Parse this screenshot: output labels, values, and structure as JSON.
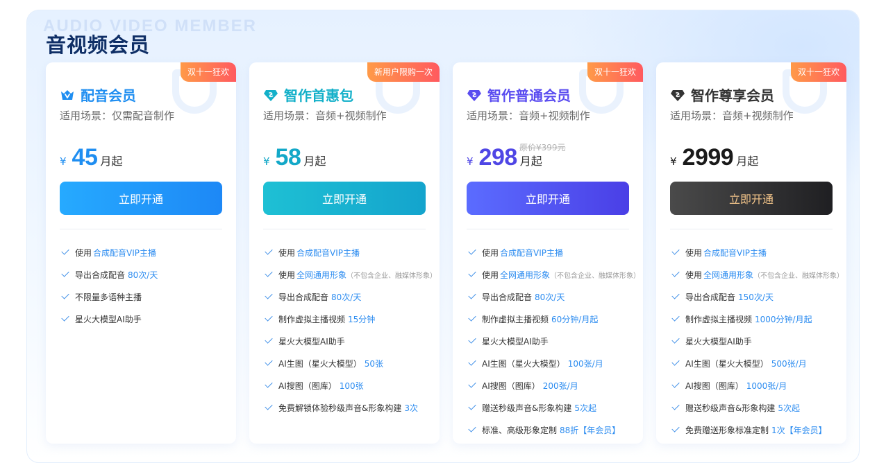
{
  "page": {
    "title": "音视频会员",
    "watermark": "AUDIO VIDEO MEMBER"
  },
  "colors": {
    "title": "#0f2f66",
    "highlight": "#2c8cf0",
    "promo_gradient": [
      "#ff9a48",
      "#ff5a5f"
    ]
  },
  "plans": [
    {
      "promo": "双十一狂欢",
      "icon": "crown-v-icon",
      "name": "配音会员",
      "name_color": "#1f8ef1",
      "scene": "适用场景：仅需配音制作",
      "currency": "¥",
      "price": "45",
      "price_color": "#1f8ef1",
      "unit": "月起",
      "original_price": "",
      "cta": "立即开通",
      "cta_gradient": [
        "#26aaff",
        "#1d88f6"
      ],
      "cta_text_color": "#ffffff",
      "features": [
        {
          "text": "使用",
          "highlight": "合成配音VIP主播",
          "note": ""
        },
        {
          "text": "导出合成配音",
          "highlight": "80次/天",
          "note": ""
        },
        {
          "text": "不限量多语种主播",
          "highlight": "",
          "note": ""
        },
        {
          "text": "星火大模型AI助手",
          "highlight": "",
          "note": ""
        }
      ]
    },
    {
      "promo": "新用户限购一次",
      "icon": "diamond-s-icon",
      "name": "智作首惠包",
      "name_color": "#13b0c9",
      "scene": "适用场景：音频+视频制作",
      "currency": "¥",
      "price": "58",
      "price_color": "#13a8c8",
      "unit": "月起",
      "original_price": "",
      "cta": "立即开通",
      "cta_gradient": [
        "#1ec0d4",
        "#14a4cd"
      ],
      "cta_text_color": "#ffffff",
      "features": [
        {
          "text": "使用",
          "highlight": "合成配音VIP主播",
          "note": ""
        },
        {
          "text": "使用",
          "highlight": "全网通用形象",
          "note": "（不包含企业、融媒体形象）"
        },
        {
          "text": "导出合成配音",
          "highlight": "80次/天",
          "note": ""
        },
        {
          "text": "制作虚拟主播视频",
          "highlight": "15分钟",
          "note": ""
        },
        {
          "text": "星火大模型AI助手",
          "highlight": "",
          "note": ""
        },
        {
          "text": "AI生图（星火大模型）",
          "highlight": "50张",
          "note": ""
        },
        {
          "text": "AI搜图（图库）",
          "highlight": "100张",
          "note": ""
        },
        {
          "text": "免费解锁体验秒级声音&形象构建",
          "highlight": "3次",
          "note": ""
        }
      ]
    },
    {
      "promo": "双十一狂欢",
      "icon": "diamond-s-icon",
      "name": "智作普通会员",
      "name_color": "#5a4cf0",
      "scene": "适用场景：音频+视频制作",
      "currency": "¥",
      "price": "298",
      "price_color": "#4f46e5",
      "unit": "月起",
      "original_price": "原价¥399元",
      "cta": "立即开通",
      "cta_gradient": [
        "#5b6cff",
        "#4a3fe6"
      ],
      "cta_text_color": "#ffffff",
      "features": [
        {
          "text": "使用",
          "highlight": "合成配音VIP主播",
          "note": ""
        },
        {
          "text": "使用",
          "highlight": "全网通用形象",
          "note": "（不包含企业、融媒体形象）"
        },
        {
          "text": "导出合成配音",
          "highlight": "80次/天",
          "note": ""
        },
        {
          "text": "制作虚拟主播视频",
          "highlight": "60分钟/月起",
          "note": ""
        },
        {
          "text": "星火大模型AI助手",
          "highlight": "",
          "note": ""
        },
        {
          "text": "AI生图（星火大模型）",
          "highlight": "100张/月",
          "note": ""
        },
        {
          "text": "AI搜图（图库）",
          "highlight": "200张/月",
          "note": ""
        },
        {
          "text": "赠送秒级声音&形象构建",
          "highlight": "5次起",
          "note": ""
        },
        {
          "text": "标准、高级形象定制",
          "highlight": "88折【年会员】",
          "note": ""
        }
      ]
    },
    {
      "promo": "双十一狂欢",
      "icon": "diamond-s-icon",
      "name": "智作尊享会员",
      "name_color": "#333333",
      "scene": "适用场景：音频+视频制作",
      "currency": "¥",
      "price": "2999",
      "price_color": "#1a1a1a",
      "unit": "月起",
      "original_price": "",
      "cta": "立即开通",
      "cta_gradient": [
        "#4a4a4a",
        "#1f1f22"
      ],
      "cta_text_color": "#f3c58a",
      "features": [
        {
          "text": "使用",
          "highlight": "合成配音VIP主播",
          "note": ""
        },
        {
          "text": "使用",
          "highlight": "全网通用形象",
          "note": "（不包含企业、融媒体形象）"
        },
        {
          "text": "导出合成配音",
          "highlight": "150次/天",
          "note": ""
        },
        {
          "text": "制作虚拟主播视频",
          "highlight": "1000分钟/月起",
          "note": ""
        },
        {
          "text": "星火大模型AI助手",
          "highlight": "",
          "note": ""
        },
        {
          "text": "AI生图（星火大模型）",
          "highlight": "500张/月",
          "note": ""
        },
        {
          "text": "AI搜图（图库）",
          "highlight": "1000张/月",
          "note": ""
        },
        {
          "text": "赠送秒级声音&形象构建",
          "highlight": "5次起",
          "note": ""
        },
        {
          "text": "免费赠送形象标准定制",
          "highlight": "1次【年会员】",
          "note": ""
        }
      ]
    }
  ]
}
